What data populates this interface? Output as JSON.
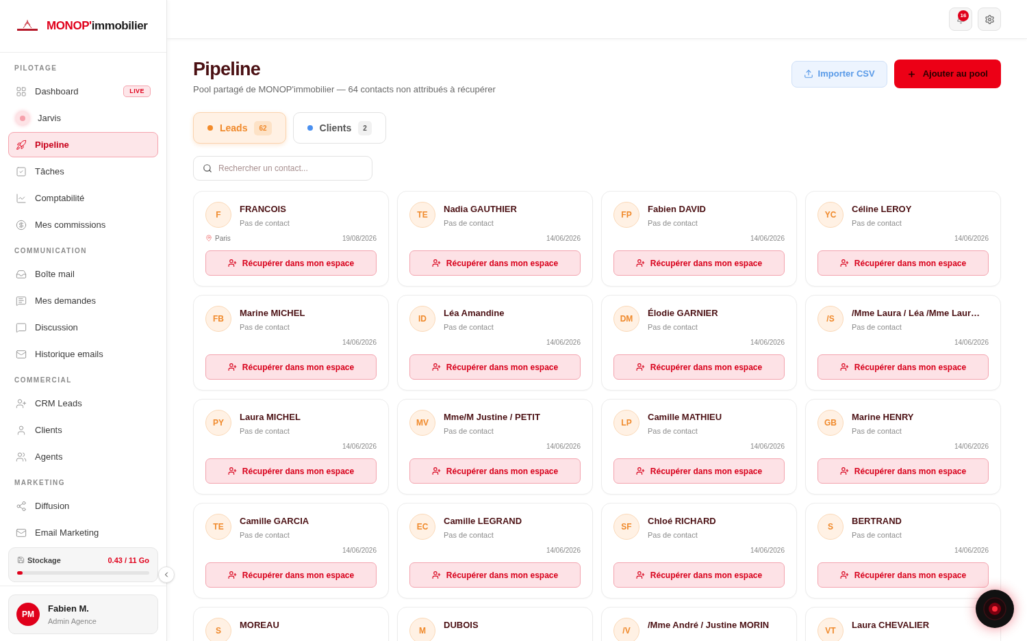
{
  "brand": {
    "part1": "MONOP'",
    "part2": "immobilier"
  },
  "sidebar": {
    "sections": [
      {
        "title": "PILOTAGE",
        "items": [
          {
            "kind": "grid",
            "label": "Dashboard",
            "badge": "LIVE",
            "selected": false
          },
          {
            "kind": "orb",
            "label": "Jarvis",
            "selected": false
          },
          {
            "kind": "rocket",
            "label": "Pipeline",
            "selected": true
          },
          {
            "kind": "check",
            "label": "Tâches",
            "selected": false
          },
          {
            "kind": "chart",
            "label": "Comptabilité",
            "selected": false
          },
          {
            "kind": "dollar",
            "label": "Mes commissions",
            "selected": false
          }
        ]
      },
      {
        "title": "COMMUNICATION",
        "items": [
          {
            "kind": "inbox",
            "label": "Boîte mail",
            "selected": false
          },
          {
            "kind": "note",
            "label": "Mes demandes",
            "selected": false
          },
          {
            "kind": "chat",
            "label": "Discussion",
            "selected": false
          },
          {
            "kind": "mail",
            "label": "Historique emails",
            "selected": false
          }
        ]
      },
      {
        "title": "COMMERCIAL",
        "items": [
          {
            "kind": "userplus",
            "label": "CRM Leads",
            "selected": false
          },
          {
            "kind": "user",
            "label": "Clients",
            "selected": false
          },
          {
            "kind": "users",
            "label": "Agents",
            "selected": false
          }
        ]
      },
      {
        "title": "MARKETING",
        "items": [
          {
            "kind": "share",
            "label": "Diffusion",
            "selected": false
          },
          {
            "kind": "mail",
            "label": "Email Marketing",
            "selected": false
          }
        ]
      }
    ],
    "storage": {
      "label": "Stockage",
      "reading": "0.43 / 11 Go",
      "level": 0.04
    },
    "user": {
      "initials": "PM",
      "name": "Fabien M.",
      "role": "Admin Agence"
    }
  },
  "topbar": {
    "notifications": "16"
  },
  "page": {
    "title": "Pipeline",
    "subtitle": "Pool partagé de MONOP'immobilier — 64 contacts non attribués à récupérer",
    "import_button": "Importer CSV",
    "add_button": "Ajouter au pool"
  },
  "tabs": [
    {
      "label": "Leads",
      "count": "62",
      "selected": true,
      "color": "#f38b2a"
    },
    {
      "label": "Clients",
      "count": "2",
      "selected": false,
      "color": "#4a90f0"
    }
  ],
  "search": {
    "placeholder": "Rechercher un contact..."
  },
  "cards": [
    {
      "initials": "F",
      "name": "FRANCOIS",
      "subtitle": "Pas de contact",
      "location": "Paris",
      "date": "19/08/2026",
      "action": "Récupérer dans mon espace"
    },
    {
      "initials": "TE",
      "name": "Nadia GAUTHIER",
      "subtitle": "Pas de contact",
      "date": "14/06/2026",
      "action": "Récupérer dans mon espace"
    },
    {
      "initials": "FP",
      "name": "Fabien DAVID",
      "subtitle": "Pas de contact",
      "date": "14/06/2026",
      "action": "Récupérer dans mon espace"
    },
    {
      "initials": "YC",
      "name": "Céline LEROY",
      "subtitle": "Pas de contact",
      "date": "14/06/2026",
      "action": "Récupérer dans mon espace"
    },
    {
      "initials": "FB",
      "name": "Marine MICHEL",
      "subtitle": "Pas de contact",
      "date": "14/06/2026",
      "action": "Récupérer dans mon espace"
    },
    {
      "initials": "ID",
      "name": "Léa Amandine",
      "subtitle": "Pas de contact",
      "date": "14/06/2026",
      "action": "Récupérer dans mon espace"
    },
    {
      "initials": "DM",
      "name": "Élodie GARNIER",
      "subtitle": "Pas de contact",
      "date": "14/06/2026",
      "action": "Récupérer dans mon espace"
    },
    {
      "initials": "/S",
      "name": "/Mme Laura / Léa /Mme Laur…",
      "subtitle": "Pas de contact",
      "date": "14/06/2026",
      "action": "Récupérer dans mon espace"
    },
    {
      "initials": "PY",
      "name": "Laura MICHEL",
      "subtitle": "Pas de contact",
      "date": "14/06/2026",
      "action": "Récupérer dans mon espace"
    },
    {
      "initials": "MV",
      "name": "Mme/M Justine / PETIT",
      "subtitle": "Pas de contact",
      "date": "14/06/2026",
      "action": "Récupérer dans mon espace"
    },
    {
      "initials": "LP",
      "name": "Camille MATHIEU",
      "subtitle": "Pas de contact",
      "date": "14/06/2026",
      "action": "Récupérer dans mon espace"
    },
    {
      "initials": "GB",
      "name": "Marine HENRY",
      "subtitle": "Pas de contact",
      "date": "14/06/2026",
      "action": "Récupérer dans mon espace"
    },
    {
      "initials": "TE",
      "name": "Camille GARCIA",
      "subtitle": "Pas de contact",
      "date": "14/06/2026",
      "action": "Récupérer dans mon espace"
    },
    {
      "initials": "EC",
      "name": "Camille LEGRAND",
      "subtitle": "Pas de contact",
      "date": "14/06/2026",
      "action": "Récupérer dans mon espace"
    },
    {
      "initials": "SF",
      "name": "Chloé RICHARD",
      "subtitle": "Pas de contact",
      "date": "14/06/2026",
      "action": "Récupérer dans mon espace"
    },
    {
      "initials": "S",
      "name": "BERTRAND",
      "subtitle": "Pas de contact",
      "date": "14/06/2026",
      "action": "Récupérer dans mon espace"
    },
    {
      "initials": "S",
      "name": "MOREAU"
    },
    {
      "initials": "M",
      "name": "DUBOIS"
    },
    {
      "initials": "/V",
      "name": "/Mme André / Justine MORIN"
    },
    {
      "initials": "VT",
      "name": "Laura CHEVALIER"
    }
  ]
}
